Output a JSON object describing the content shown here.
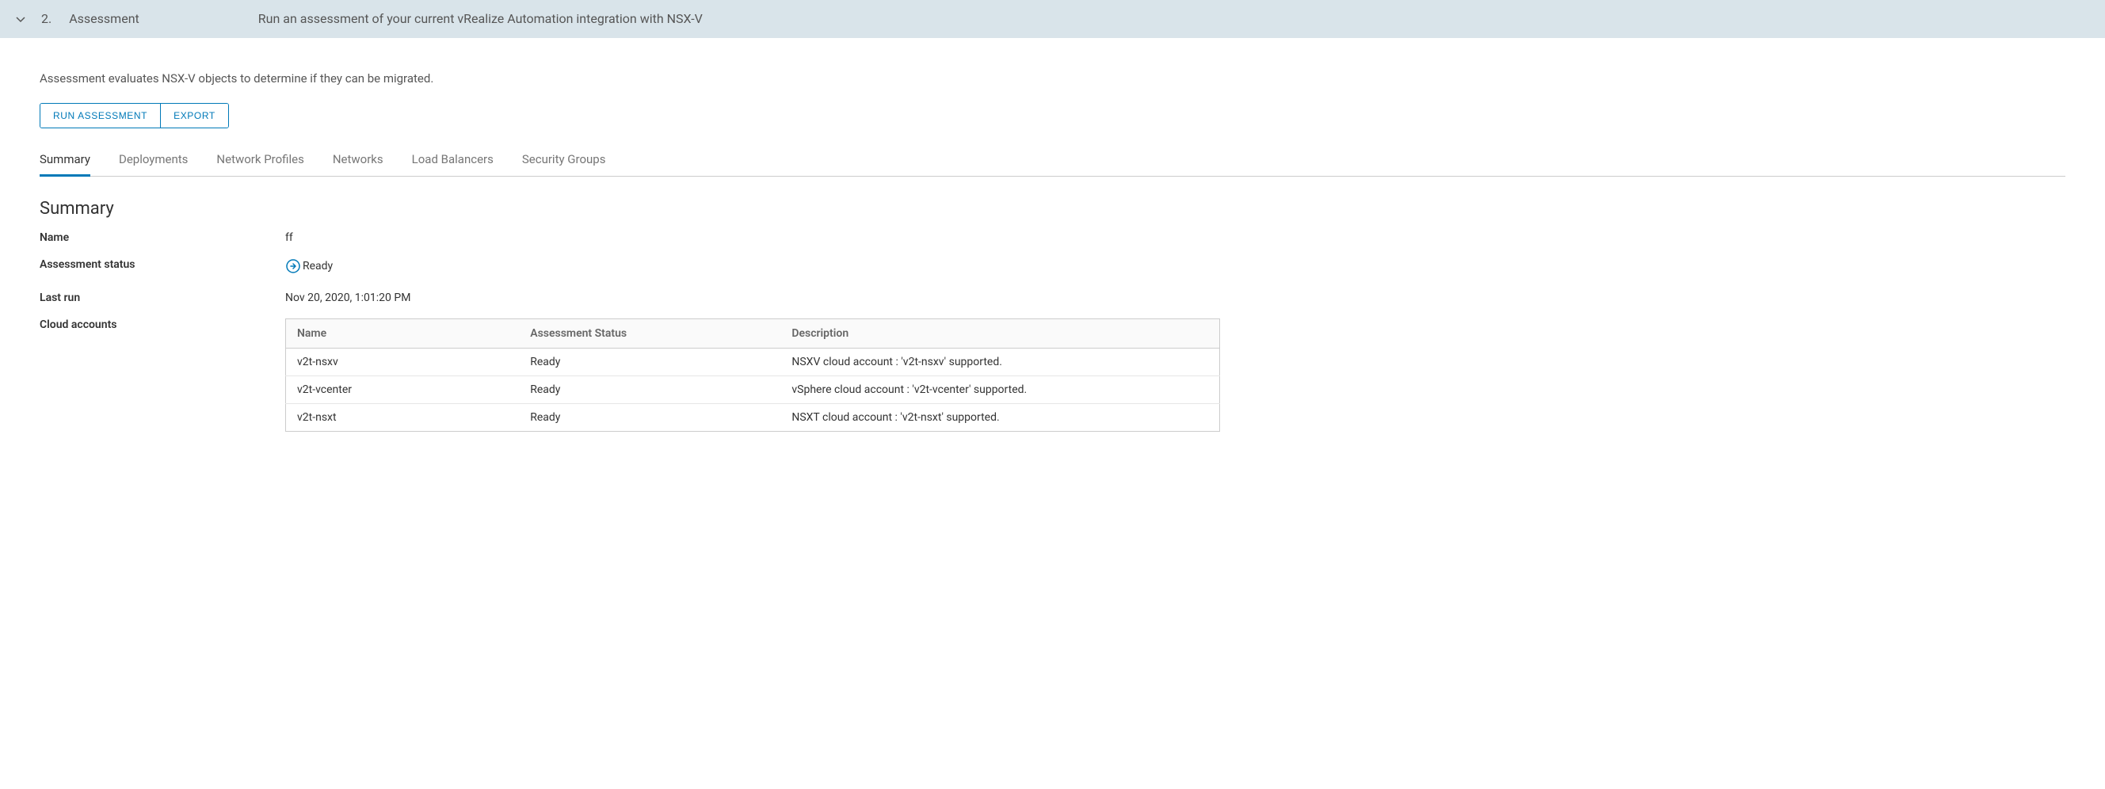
{
  "header": {
    "step_number": "2.",
    "step_title": "Assessment",
    "step_description": "Run an assessment of your current vRealize Automation integration with NSX-V"
  },
  "intro": "Assessment evaluates NSX-V objects to determine if they can be migrated.",
  "buttons": {
    "run_assessment": "RUN ASSESSMENT",
    "export": "EXPORT"
  },
  "tabs": [
    {
      "label": "Summary"
    },
    {
      "label": "Deployments"
    },
    {
      "label": "Network Profiles"
    },
    {
      "label": "Networks"
    },
    {
      "label": "Load Balancers"
    },
    {
      "label": "Security Groups"
    }
  ],
  "summary": {
    "title": "Summary",
    "labels": {
      "name": "Name",
      "status": "Assessment status",
      "last_run": "Last run",
      "cloud_accounts": "Cloud accounts"
    },
    "name": "ff",
    "status": "Ready",
    "last_run": "Nov 20, 2020, 1:01:20 PM",
    "table": {
      "headers": {
        "name": "Name",
        "status": "Assessment Status",
        "description": "Description"
      },
      "rows": [
        {
          "name": "v2t-nsxv",
          "status": "Ready",
          "description": "NSXV cloud account : 'v2t-nsxv' supported."
        },
        {
          "name": "v2t-vcenter",
          "status": "Ready",
          "description": "vSphere cloud account : 'v2t-vcenter' supported."
        },
        {
          "name": "v2t-nsxt",
          "status": "Ready",
          "description": "NSXT cloud account : 'v2t-nsxt' supported."
        }
      ]
    }
  }
}
